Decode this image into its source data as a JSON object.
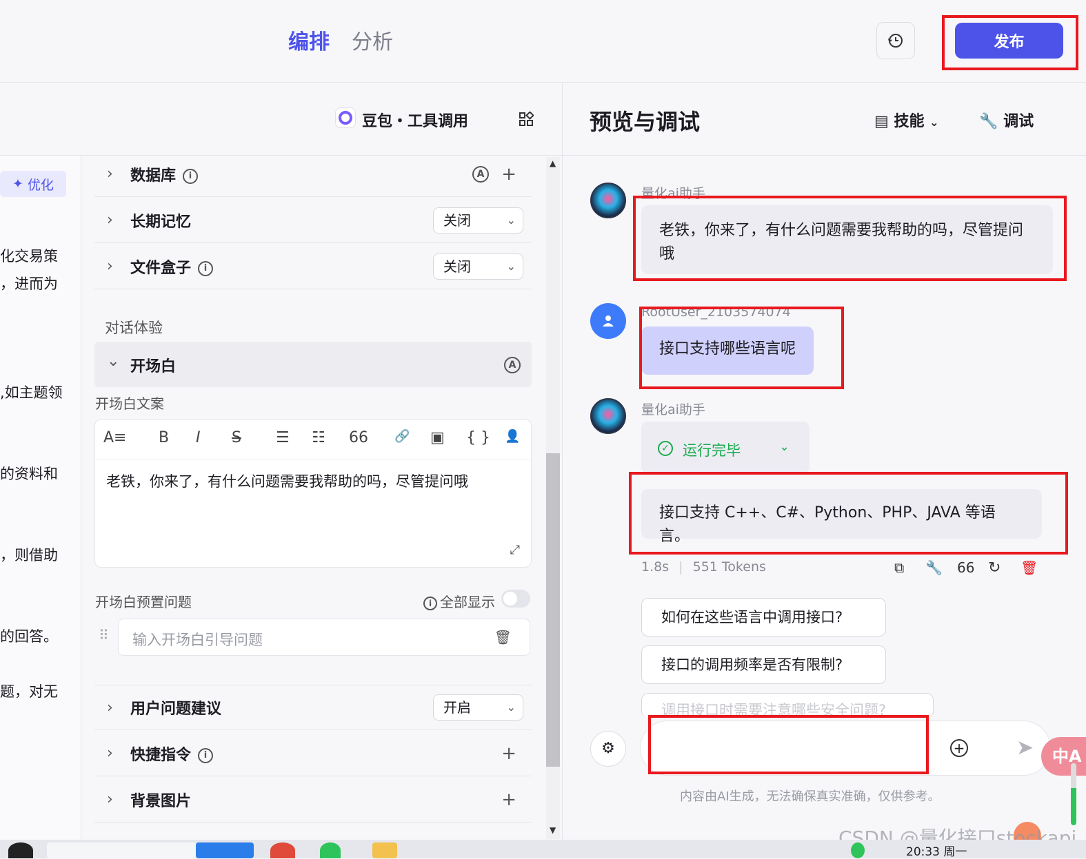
{
  "topbar": {
    "tab_active": "编排",
    "tab_inactive": "分析",
    "history_icon": "history-icon",
    "publish_label": "发布"
  },
  "model_bar": {
    "model_name": "豆包・工具调用",
    "grid_icon": "grid-icon"
  },
  "left_strip": {
    "optimize_label": "优化",
    "fragments": [
      "化交易策",
      "，进而为",
      ",如主题领",
      "的资料和",
      "，则借助",
      "的回答。",
      "题，对无"
    ]
  },
  "settings": {
    "database_label": "数据库",
    "long_memory_label": "长期记忆",
    "long_memory_value": "关闭",
    "file_box_label": "文件盒子",
    "file_box_value": "关闭",
    "dialog_experience_label": "对话体验",
    "opening_label": "开场白",
    "opening_copy_label": "开场白文案",
    "opening_text": "老铁，你来了，有什么问题需要我帮助的吗，尽管提问哦",
    "preset_questions_label": "开场白预置问题",
    "show_all_label": "全部显示",
    "question_placeholder": "输入开场白引导问题",
    "user_suggestions_label": "用户问题建议",
    "user_suggestions_value": "开启",
    "shortcuts_label": "快捷指令",
    "background_label": "背景图片"
  },
  "editor_toolbar": [
    "A≡",
    "B",
    "I",
    "S",
    "☰",
    "☷",
    "66",
    "🔗",
    "▣",
    "{ }",
    "👤"
  ],
  "preview": {
    "title": "预览与调试",
    "skills_label": "技能",
    "debug_label": "调试",
    "messages": [
      {
        "sender": "量化ai助手",
        "text": "老铁，你来了，有什么问题需要我帮助的吗，尽管提问哦"
      },
      {
        "sender": "RootUser_2103574074",
        "text": "接口支持哪些语言呢"
      },
      {
        "sender": "量化ai助手",
        "status": "运行完毕",
        "text": "接口支持 C++、C#、Python、PHP、JAVA 等语言。"
      }
    ],
    "meta_time": "1.8s",
    "meta_tokens": "551 Tokens",
    "suggestions": [
      "如何在这些语言中调用接口?",
      "接口的调用频率是否有限制?",
      "调用接口时需要注意哪些安全问题?"
    ],
    "disclaimer": "内容由AI生成，无法确保真实准确，仅供参考。"
  },
  "overlay": {
    "translate_label": "中A",
    "watermark": "CSDN @量化接口stockapi",
    "clock": "20:33 周一"
  },
  "colors": {
    "accent": "#4d53e8",
    "highlight_box": "#e8191e",
    "success": "#1aab4e",
    "user_bubble": "#cfd0fb"
  }
}
